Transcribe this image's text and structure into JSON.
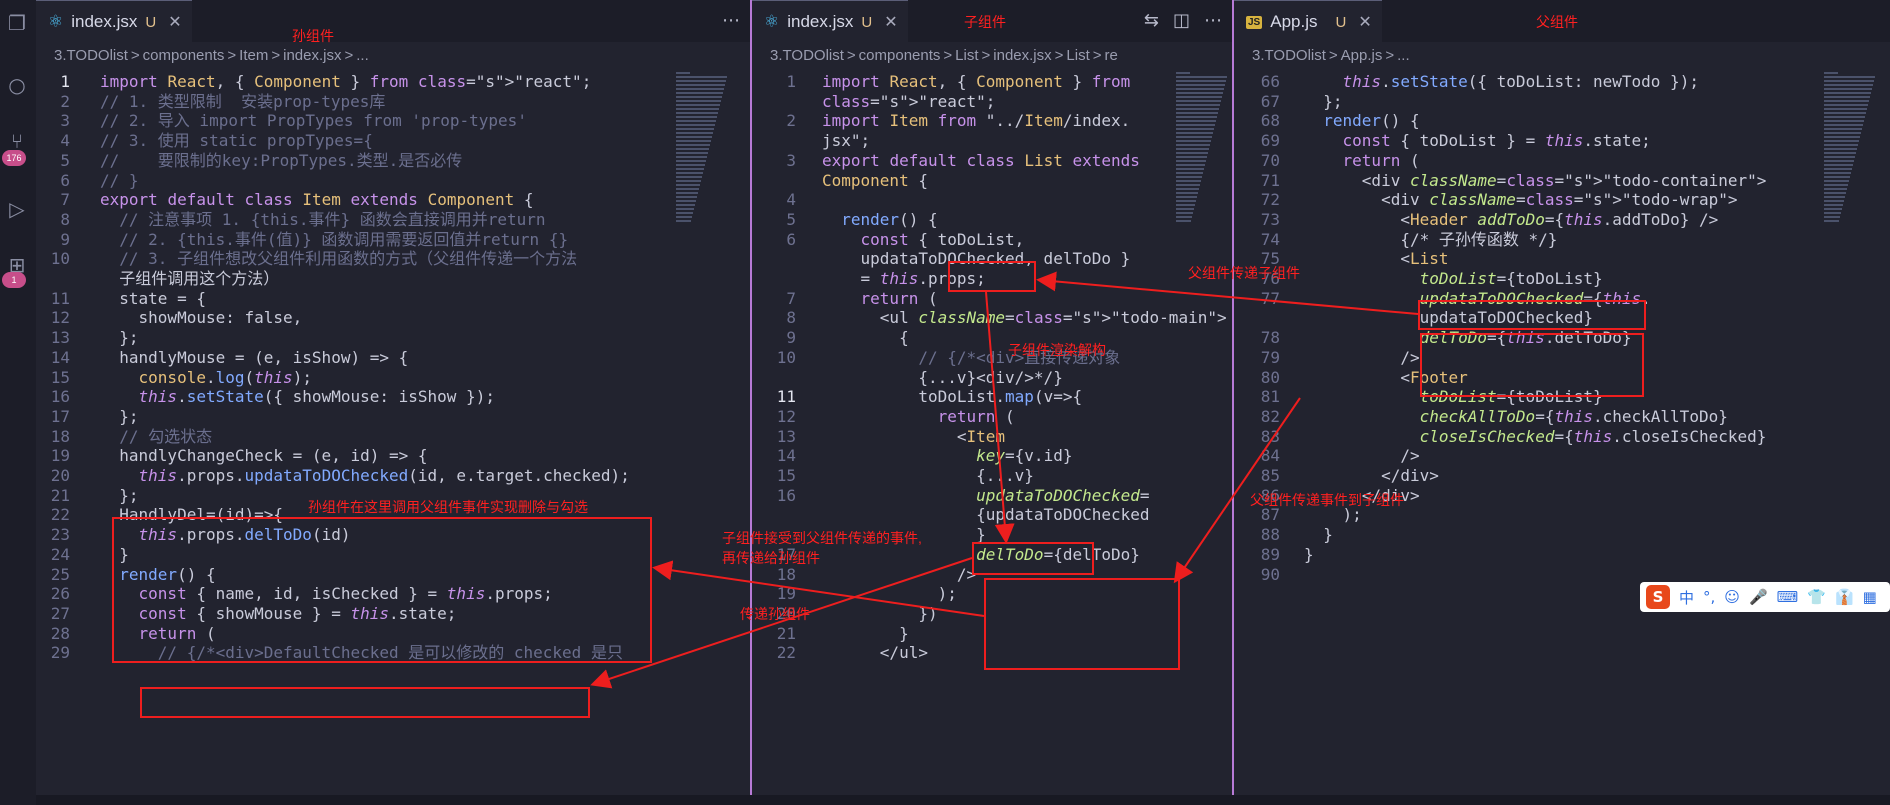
{
  "activity": {
    "badge1": "176",
    "badge2": "1"
  },
  "pane1": {
    "tab": {
      "title": "index.jsx",
      "badge": "U",
      "close": "✕"
    },
    "tab_note": "孙组件",
    "breadcrumbs": [
      "3.TODOlist",
      ">",
      "components",
      ">",
      "Item",
      ">",
      "index.jsx",
      ">",
      "..."
    ],
    "lines": [
      {
        "n": "1",
        "code": "import React, { Component } from \"react\";"
      },
      {
        "n": "2",
        "code": "// 1. 类型限制  安装prop-types库"
      },
      {
        "n": "3",
        "code": "// 2. 导入 import PropTypes from 'prop-types'"
      },
      {
        "n": "4",
        "code": "// 3. 使用 static propTypes={"
      },
      {
        "n": "5",
        "code": "//    要限制的key:PropTypes.类型.是否必传"
      },
      {
        "n": "6",
        "code": "// }"
      },
      {
        "n": "7",
        "code": "export default class Item extends Component {"
      },
      {
        "n": "8",
        "code": "  // 注意事项 1. {this.事件} 函数会直接调用并return"
      },
      {
        "n": "9",
        "code": "  // 2. {this.事件(值)} 函数调用需要返回值并return {}"
      },
      {
        "n": "10",
        "code": "  // 3. 子组件想改父组件利用函数的方式（父组件传递一个方法"
      },
      {
        "n": "",
        "code": "  子组件调用这个方法）"
      },
      {
        "n": "11",
        "code": "  state = {"
      },
      {
        "n": "12",
        "code": "    showMouse: false,"
      },
      {
        "n": "13",
        "code": "  };"
      },
      {
        "n": "14",
        "code": "  handlyMouse = (e, isShow) => {"
      },
      {
        "n": "15",
        "code": "    console.log(this);"
      },
      {
        "n": "16",
        "code": "    this.setState({ showMouse: isShow });"
      },
      {
        "n": "17",
        "code": "  };"
      },
      {
        "n": "18",
        "code": "  // 勾选状态"
      },
      {
        "n": "19",
        "code": "  handlyChangeCheck = (e, id) => {"
      },
      {
        "n": "20",
        "code": "    this.props.updataToDOChecked(id, e.target.checked);"
      },
      {
        "n": "21",
        "code": "  };"
      },
      {
        "n": "22",
        "code": "  HandlyDel=(id)=>{"
      },
      {
        "n": "23",
        "code": "    this.props.delToDo(id)"
      },
      {
        "n": "24",
        "code": "  }"
      },
      {
        "n": "25",
        "code": "  render() {"
      },
      {
        "n": "26",
        "code": "    const { name, id, isChecked } = this.props;"
      },
      {
        "n": "27",
        "code": "    const { showMouse } = this.state;"
      },
      {
        "n": "28",
        "code": "    return ("
      },
      {
        "n": "29",
        "code": "      // {/*<div>DefaultChecked 是可以修改的 checked 是只"
      }
    ]
  },
  "pane2": {
    "tab": {
      "title": "index.jsx",
      "badge": "U",
      "close": "✕"
    },
    "tab_note": "子组件",
    "breadcrumbs": [
      "3.TODOlist",
      ">",
      "components",
      ">",
      "List",
      ">",
      "index.jsx",
      ">",
      "List",
      ">",
      "re"
    ],
    "lines": [
      {
        "n": "1",
        "code": "import React, { Component } from"
      },
      {
        "n": "",
        "code": "\"react\";"
      },
      {
        "n": "2",
        "code": "import Item from \"../Item/index."
      },
      {
        "n": "",
        "code": "jsx\";"
      },
      {
        "n": "3",
        "code": "export default class List extends"
      },
      {
        "n": "",
        "code": "Component {"
      },
      {
        "n": "4",
        "code": ""
      },
      {
        "n": "5",
        "code": "  render() {"
      },
      {
        "n": "6",
        "code": "    const { toDoList,"
      },
      {
        "n": "",
        "code": "    updataToDOChecked, delToDo }"
      },
      {
        "n": "",
        "code": "    = this.props;"
      },
      {
        "n": "7",
        "code": "    return ("
      },
      {
        "n": "8",
        "code": "      <ul className=\"todo-main\">"
      },
      {
        "n": "9",
        "code": "        {"
      },
      {
        "n": "10",
        "code": "          // {/*<div>直接传递对象"
      },
      {
        "n": "",
        "code": "          {...v}<div/>*/}"
      },
      {
        "n": "11",
        "code": "          toDoList.map(v=>{"
      },
      {
        "n": "12",
        "code": "            return ("
      },
      {
        "n": "13",
        "code": "              <Item"
      },
      {
        "n": "14",
        "code": "                key={v.id}"
      },
      {
        "n": "15",
        "code": "                {...v}"
      },
      {
        "n": "16",
        "code": "                updataToDOChecked="
      },
      {
        "n": "",
        "code": "                {updataToDOChecked"
      },
      {
        "n": "",
        "code": "                }"
      },
      {
        "n": "17",
        "code": "                delToDo={delToDo}"
      },
      {
        "n": "18",
        "code": "              />"
      },
      {
        "n": "19",
        "code": "            );"
      },
      {
        "n": "20",
        "code": "          })"
      },
      {
        "n": "21",
        "code": "        }"
      },
      {
        "n": "22",
        "code": "      </ul>"
      }
    ]
  },
  "pane3": {
    "tab": {
      "title": "App.js",
      "badge": "U",
      "close": "✕"
    },
    "tab_note": "父组件",
    "breadcrumbs": [
      "3.TODOlist",
      ">",
      "App.js",
      ">",
      "..."
    ],
    "lines": [
      {
        "n": "66",
        "code": "    this.setState({ toDoList: newTodo });"
      },
      {
        "n": "67",
        "code": "  };"
      },
      {
        "n": "68",
        "code": "  render() {"
      },
      {
        "n": "69",
        "code": "    const { toDoList } = this.state;"
      },
      {
        "n": "70",
        "code": "    return ("
      },
      {
        "n": "71",
        "code": "      <div className=\"todo-container\">"
      },
      {
        "n": "72",
        "code": "        <div className=\"todo-wrap\">"
      },
      {
        "n": "73",
        "code": "          <Header addToDo={this.addToDo} />"
      },
      {
        "n": "74",
        "code": "          {/* 子孙传函数 */}"
      },
      {
        "n": "75",
        "code": "          <List"
      },
      {
        "n": "76",
        "code": "            toDoList={toDoList}"
      },
      {
        "n": "77",
        "code": "            updataToDOChecked={this."
      },
      {
        "n": "",
        "code": "            updataToDOChecked}"
      },
      {
        "n": "78",
        "code": "            delToDo={this.delToDo}"
      },
      {
        "n": "79",
        "code": "          />"
      },
      {
        "n": "80",
        "code": "          <Footer"
      },
      {
        "n": "81",
        "code": "            toDoList={toDoList}"
      },
      {
        "n": "82",
        "code": "            checkAllToDo={this.checkAllToDo}"
      },
      {
        "n": "83",
        "code": "            closeIsChecked={this.closeIsChecked}"
      },
      {
        "n": "84",
        "code": "          />"
      },
      {
        "n": "85",
        "code": "        </div>"
      },
      {
        "n": "86",
        "code": "      </div>"
      },
      {
        "n": "87",
        "code": "    );"
      },
      {
        "n": "88",
        "code": "  }"
      },
      {
        "n": "89",
        "code": "}"
      },
      {
        "n": "90",
        "code": ""
      }
    ]
  },
  "annotations": {
    "grandchild_calls_parent": "孙组件在这里调用父组件事件实现删除与勾选",
    "parent_to_child": "父组件传递子组件",
    "child_destructure": "子组件渲染解构",
    "child_receive_1": "子组件接受到父组件传递的事件,",
    "child_receive_2": "再传递给孙组件",
    "pass_to_grandchild": "传递孙组件",
    "parent_event_to_child": "父组件传递事件到子组件"
  },
  "ime": {
    "logo": "S",
    "items": [
      "中",
      "°,",
      "☺",
      "🎤",
      "⌨",
      "👕",
      "👔",
      "▦"
    ]
  },
  "colors": {
    "annotation": "#ee1e1e",
    "background": "#22232f"
  }
}
